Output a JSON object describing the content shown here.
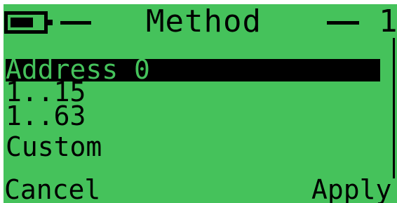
{
  "header": {
    "title": "Method",
    "page_indicator": "1"
  },
  "menu": {
    "items": [
      {
        "label": "Address 0",
        "selected": true
      },
      {
        "label": "1..15",
        "selected": false
      },
      {
        "label": "1..63",
        "selected": false
      },
      {
        "label": "Custom",
        "selected": false
      }
    ]
  },
  "softkeys": {
    "left": "Cancel",
    "right": "Apply"
  },
  "icons": {
    "battery": "battery-icon"
  },
  "colors": {
    "lcd_background": "#45c25b",
    "foreground": "#000000"
  }
}
